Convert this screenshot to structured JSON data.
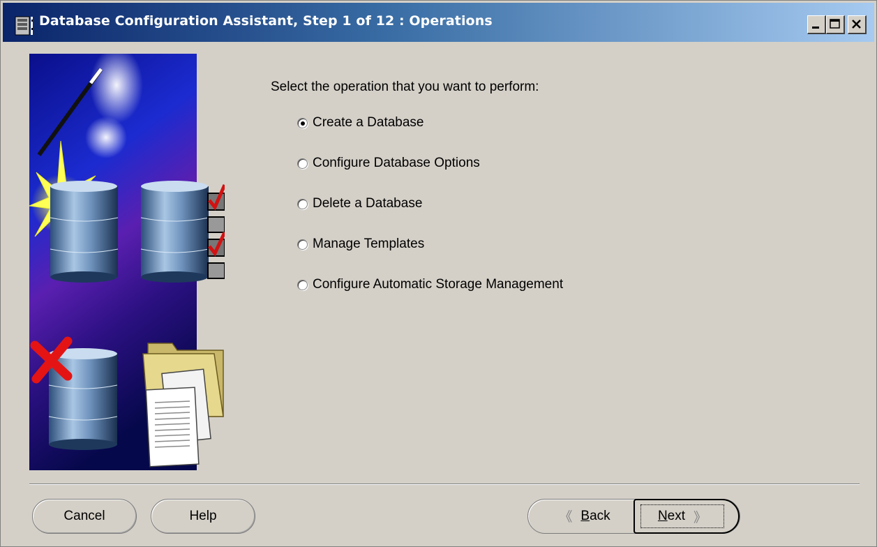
{
  "window": {
    "title": "Database Configuration Assistant, Step 1 of 12 : Operations",
    "controls": {
      "minimize": "minimize",
      "maximize": "maximize",
      "close": "close"
    }
  },
  "main": {
    "prompt": "Select the operation that you want to perform:",
    "options": [
      {
        "label": "Create a Database",
        "checked": true
      },
      {
        "label": "Configure Database Options",
        "checked": false
      },
      {
        "label": "Delete a Database",
        "checked": false
      },
      {
        "label": "Manage Templates",
        "checked": false
      },
      {
        "label": "Configure Automatic Storage Management",
        "checked": false
      }
    ]
  },
  "footer": {
    "cancel_label": "Cancel",
    "help_label": "Help",
    "back_label": "Back",
    "next_label": "Next"
  },
  "icons": {
    "app": "database-icon",
    "back": "chevron-left-icon",
    "next": "chevron-right-icon"
  },
  "colors": {
    "titlebar_start": "#0a246a",
    "titlebar_end": "#a6caf0",
    "window_bg": "#d4d0c8"
  }
}
